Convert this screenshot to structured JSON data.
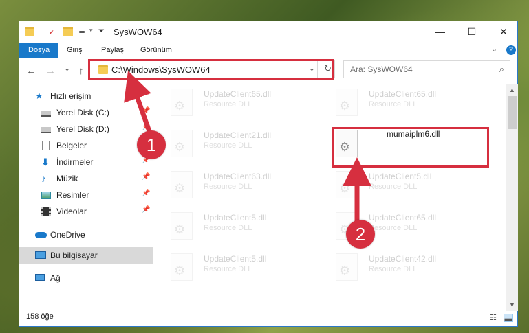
{
  "window": {
    "title": "SysWOW64",
    "controls": {
      "minimize": "—",
      "maximize": "☐",
      "close": "✕"
    }
  },
  "ribbon": {
    "tabs": [
      {
        "label": "Dosya",
        "active": true
      },
      {
        "label": "Giriş"
      },
      {
        "label": "Paylaş"
      },
      {
        "label": "Görünüm"
      }
    ],
    "collapse_icon": "chevron-down-icon",
    "help_icon": "help-icon",
    "help_label": "?"
  },
  "nav": {
    "back": "←",
    "forward": "→",
    "recent": "⌄",
    "up": "↑",
    "address": "C:\\Windows\\SysWOW64",
    "address_dropdown": "⌄",
    "refresh": "↻",
    "search_placeholder": "Ara: SysWOW64",
    "search_glyph": "⌕"
  },
  "sidebar": {
    "items": [
      {
        "label": "Hızlı erişim",
        "icon": "star-icon"
      },
      {
        "label": "Yerel Disk (C:)",
        "icon": "drive-icon",
        "pinned": true
      },
      {
        "label": "Yerel Disk (D:)",
        "icon": "drive-icon",
        "pinned": true
      },
      {
        "label": "Belgeler",
        "icon": "documents-icon",
        "pinned": true
      },
      {
        "label": "İndirmeler",
        "icon": "download-icon",
        "pinned": true
      },
      {
        "label": "Müzik",
        "icon": "music-icon",
        "pinned": true
      },
      {
        "label": "Resimler",
        "icon": "pictures-icon",
        "pinned": true
      },
      {
        "label": "Videolar",
        "icon": "video-icon",
        "pinned": true
      },
      {
        "label": "OneDrive",
        "icon": "cloud-icon"
      },
      {
        "label": "Bu bilgisayar",
        "icon": "computer-icon",
        "selected": true
      },
      {
        "label": "Ağ",
        "icon": "network-icon"
      }
    ]
  },
  "files": [
    {
      "name": "UpdateClient65.dll",
      "desc": "Resource DLL"
    },
    {
      "name": "UpdateClient65.dll",
      "desc": "Resource DLL"
    },
    {
      "name": "UpdateClient21.dll",
      "desc": "Resource DLL"
    },
    {
      "name": "mumaiplm6.dll",
      "desc": ""
    },
    {
      "name": "UpdateClient63.dll",
      "desc": "Resource DLL"
    },
    {
      "name": "UpdateClient5.dll",
      "desc": "Resource DLL"
    },
    {
      "name": "UpdateClient5.dll",
      "desc": "Resource DLL"
    },
    {
      "name": "UpdateClient65.dll",
      "desc": "Resource DLL"
    },
    {
      "name": "UpdateClient5.dll",
      "desc": "Resource DLL"
    },
    {
      "name": "UpdateClient42.dll",
      "desc": "Resource DLL"
    }
  ],
  "status": {
    "item_count": "158 öğe"
  },
  "annotations": {
    "step1": "1",
    "step2": "2",
    "color": "#d62f3f"
  }
}
